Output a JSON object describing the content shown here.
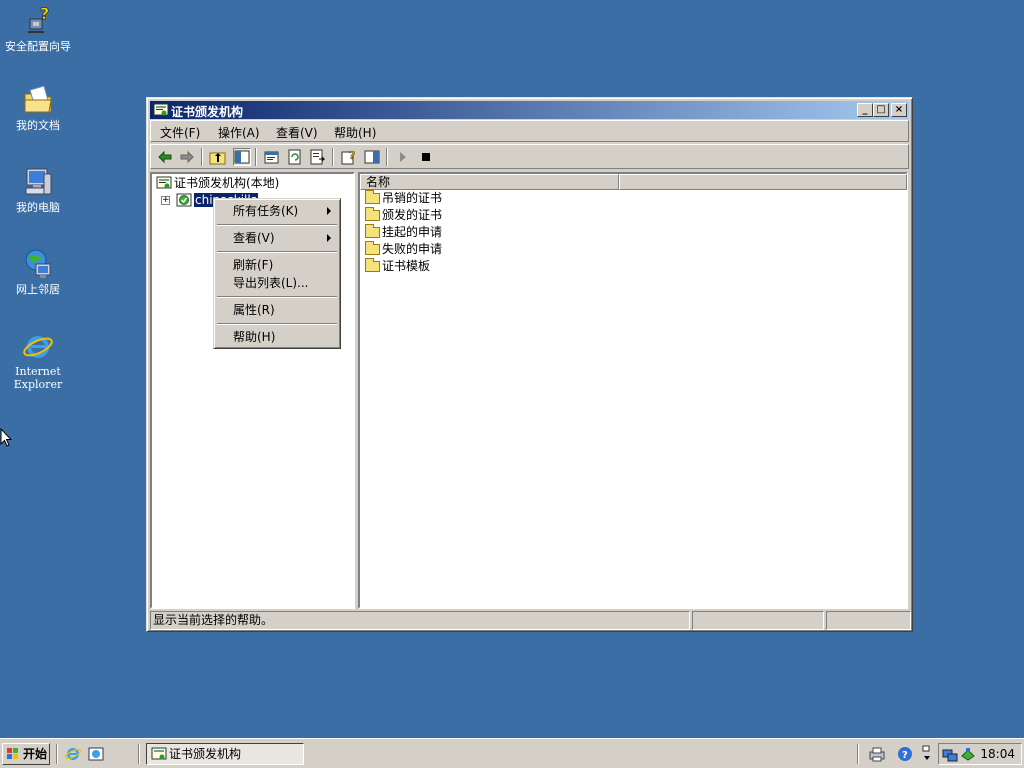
{
  "desktop": {
    "icons": [
      {
        "label": "安全配置向导",
        "icon": "security-wizard-icon"
      },
      {
        "label": "我的文档",
        "icon": "my-documents-icon"
      },
      {
        "label": "我的电脑",
        "icon": "my-computer-icon"
      },
      {
        "label": "网上邻居",
        "icon": "network-places-icon"
      },
      {
        "label": "Internet\nExplorer",
        "label_line1": "Internet",
        "label_line2": "Explorer",
        "icon": "internet-explorer-icon"
      }
    ]
  },
  "window": {
    "title": "证书颁发机构",
    "menu": [
      "文件(F)",
      "操作(A)",
      "查看(V)",
      "帮助(H)"
    ],
    "tree": {
      "root": "证书颁发机构(本地)",
      "child": "chinaskills"
    },
    "list": {
      "column_name": "名称",
      "items": [
        "吊销的证书",
        "颁发的证书",
        "挂起的申请",
        "失败的申请",
        "证书模板"
      ]
    },
    "status": "显示当前选择的帮助。"
  },
  "context_menu": {
    "items": [
      "所有任务(K)",
      "查看(V)",
      "刷新(F)",
      "导出列表(L)...",
      "属性(R)",
      "帮助(H)"
    ]
  },
  "taskbar": {
    "start_label": "开始",
    "task_label": "证书颁发机构",
    "clock": "18:04"
  },
  "colors": {
    "desktop": "#3a6ea5",
    "titlebar_start": "#0a246a",
    "titlebar_end": "#a6caf0",
    "selection": "#0a246a"
  }
}
